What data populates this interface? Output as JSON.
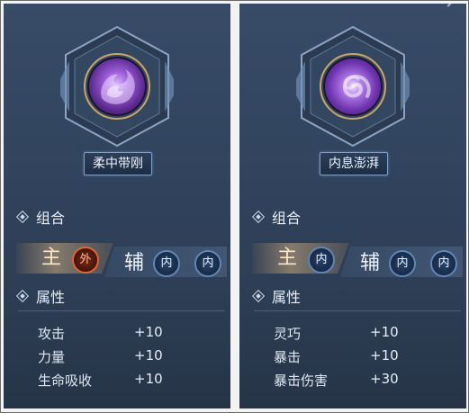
{
  "panels": [
    {
      "skill_name": "柔中带刚",
      "combo_title": "组合",
      "main_label": "主",
      "main_tag": "外",
      "aux_label": "辅",
      "aux_tags": [
        "内",
        "内"
      ],
      "attr_title": "属性",
      "attributes": [
        {
          "name": "攻击",
          "value": "+10"
        },
        {
          "name": "力量",
          "value": "+10"
        },
        {
          "name": "生命吸收",
          "value": "+10"
        }
      ],
      "orb_icon": "purple-flame-swirl-icon",
      "colors": {
        "orb": "#7a3fb0",
        "main_tag": "#e2642f"
      }
    },
    {
      "skill_name": "内息澎湃",
      "combo_title": "组合",
      "main_label": "主",
      "main_tag": "内",
      "aux_label": "辅",
      "aux_tags": [
        "内",
        "内"
      ],
      "attr_title": "属性",
      "attributes": [
        {
          "name": "灵巧",
          "value": "+10"
        },
        {
          "name": "暴击",
          "value": "+10"
        },
        {
          "name": "暴击伤害",
          "value": "+30"
        }
      ],
      "orb_icon": "purple-vortex-icon",
      "colors": {
        "orb": "#8a4fc8",
        "main_tag": "#5f87b8"
      }
    }
  ]
}
